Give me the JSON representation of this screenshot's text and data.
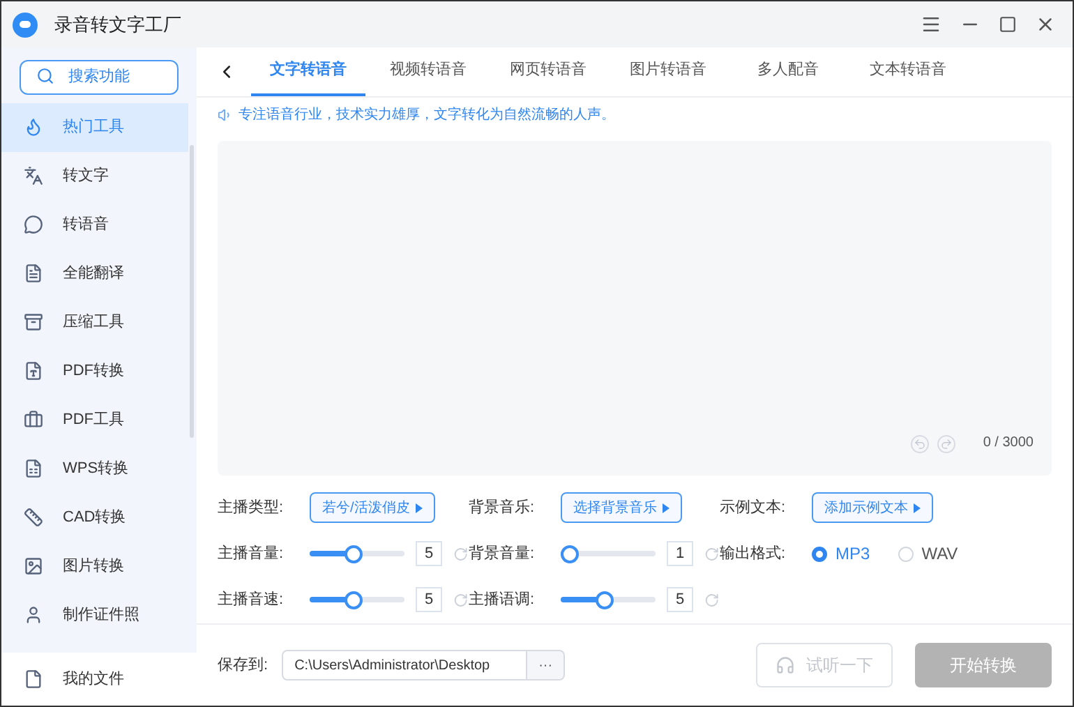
{
  "window": {
    "title": "录音转文字工厂"
  },
  "sidebar": {
    "search": {
      "placeholder": "搜索功能"
    },
    "items": [
      {
        "label": "热门工具",
        "selected": true
      },
      {
        "label": "转文字",
        "selected": false
      },
      {
        "label": "转语音",
        "selected": false
      },
      {
        "label": "全能翻译",
        "selected": false
      },
      {
        "label": "压缩工具",
        "selected": false
      },
      {
        "label": "PDF转换",
        "selected": false
      },
      {
        "label": "PDF工具",
        "selected": false
      },
      {
        "label": "WPS转换",
        "selected": false
      },
      {
        "label": "CAD转换",
        "selected": false
      },
      {
        "label": "图片转换",
        "selected": false
      },
      {
        "label": "制作证件照",
        "selected": false
      }
    ],
    "footer_item": {
      "label": "我的文件"
    }
  },
  "tabs": [
    {
      "label": "文字转语音",
      "selected": true
    },
    {
      "label": "视频转语音",
      "selected": false
    },
    {
      "label": "网页转语音",
      "selected": false
    },
    {
      "label": "图片转语音",
      "selected": false
    },
    {
      "label": "多人配音",
      "selected": false
    },
    {
      "label": "文本转语音",
      "selected": false
    }
  ],
  "notice": "专注语音行业，技术实力雄厚，文字转化为自然流畅的人声。",
  "editor": {
    "counter": "0 / 3000"
  },
  "settings": [
    [
      {
        "kind": "picker",
        "label": "主播类型:",
        "value": "若兮/活泼俏皮"
      },
      {
        "kind": "picker",
        "label": "背景音乐:",
        "value": "选择背景音乐"
      },
      {
        "kind": "picker",
        "label": "示例文本:",
        "value": "添加示例文本"
      }
    ],
    [
      {
        "kind": "slider",
        "label": "主播音量:",
        "level": 0.45,
        "reading": "5"
      },
      {
        "kind": "slider",
        "label": "背景音量:",
        "level": 0.0,
        "reading": "1"
      },
      {
        "kind": "format",
        "label": "输出格式:",
        "options": [
          {
            "label": "MP3",
            "selected": true
          },
          {
            "label": "WAV",
            "selected": false
          }
        ]
      }
    ],
    [
      {
        "kind": "slider",
        "label": "主播音速:",
        "level": 0.45,
        "reading": "5"
      },
      {
        "kind": "slider",
        "label": "主播语调:",
        "level": 0.45,
        "reading": "5"
      }
    ]
  ],
  "save": {
    "label": "保存到:",
    "path": "C:\\Users\\Administrator\\Desktop",
    "browse": "···"
  },
  "buttons": [
    {
      "kind": "preview",
      "label": "试听一下",
      "disabled": true
    },
    {
      "kind": "start",
      "label": "开始转换",
      "disabled": true
    }
  ]
}
